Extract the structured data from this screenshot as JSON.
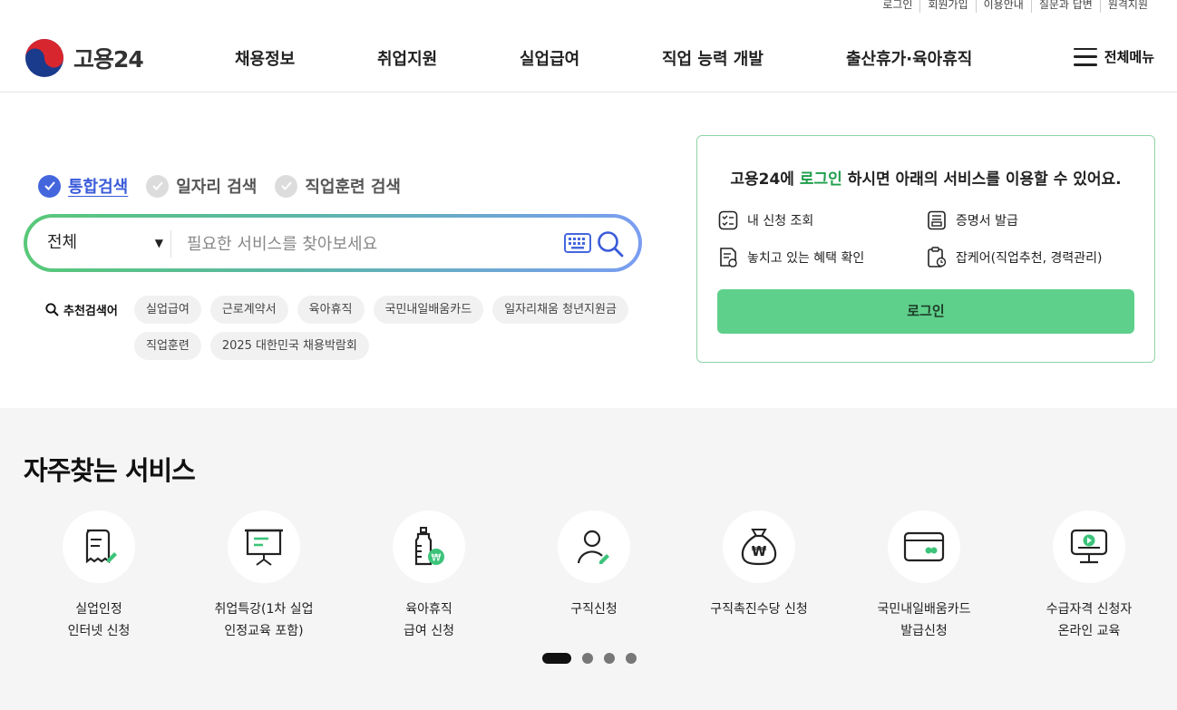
{
  "utility": [
    "로그인",
    "회원가입",
    "이용안내",
    "질문과 답변",
    "원격지원"
  ],
  "logo": {
    "text": "고용24"
  },
  "gnb": [
    "채용정보",
    "취업지원",
    "실업급여",
    "직업 능력 개발",
    "출산휴가·육아휴직"
  ],
  "allmenu_label": "전체메뉴",
  "search": {
    "tabs": [
      "통합검색",
      "일자리 검색",
      "직업훈련 검색"
    ],
    "active_tab": "통합검색",
    "category": "전체",
    "placeholder": "필요한 서비스를 찾아보세요",
    "recommend_label": "추천검색어",
    "chips": [
      "실업급여",
      "근로계약서",
      "육아휴직",
      "국민내일배움카드",
      "일자리채움 청년지원금",
      "직업훈련",
      "2025 대한민국 채용박람회"
    ]
  },
  "login_card": {
    "title_pre": "고용24에 ",
    "title_hl": "로그인",
    "title_post": " 하시면 아래의 서비스를 이용할 수 있어요.",
    "services": [
      "내 신청 조회",
      "증명서 발급",
      "놓치고 있는 혜택 확인",
      "잡케어(직업추천, 경력관리)"
    ],
    "button": "로그인"
  },
  "frequent": {
    "title": "자주찾는 서비스",
    "items": [
      {
        "label": "실업인정\n인터넷 신청",
        "icon": "document-pen-icon"
      },
      {
        "label": "취업특강(1차 실업\n인정교육 포함)",
        "icon": "presentation-board-icon"
      },
      {
        "label": "육아휴직\n급여 신청",
        "icon": "baby-bottle-icon"
      },
      {
        "label": "구직신청",
        "icon": "person-pen-icon"
      },
      {
        "label": "구직촉진수당 신청",
        "icon": "money-bag-icon"
      },
      {
        "label": "국민내일배움카드\n발급신청",
        "icon": "card-icon"
      },
      {
        "label": "수급자격 신청자\n온라인 교육",
        "icon": "monitor-play-icon"
      }
    ],
    "pages": 4,
    "active_page": 1
  },
  "colors": {
    "accent_green": "#5fd08b",
    "accent_blue": "#4466dd",
    "brand_text": "#1f9e4c"
  }
}
